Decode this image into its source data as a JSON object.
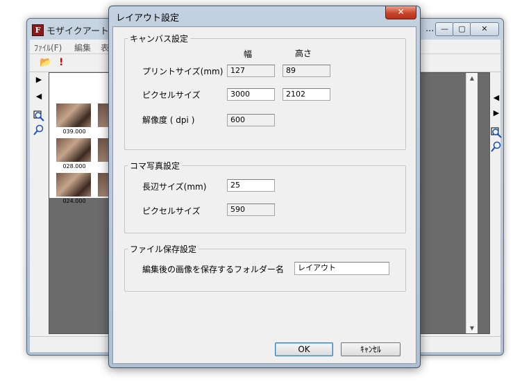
{
  "app_window": {
    "app_icon_letter": "F",
    "title": "モザイクアートテ",
    "title_overflow": "...",
    "controls": {
      "minimize": "—",
      "maximize": "▢",
      "close": "✕"
    },
    "menu": [
      "ﾌｧｲﾙ(F)",
      "編集",
      "表"
    ],
    "toolbar": {
      "open_icon": "📂",
      "alert_icon": "!"
    },
    "side_left": {
      "next": "▶",
      "prev": "◀"
    },
    "side_right": {
      "prev": "◀",
      "next": "▶"
    },
    "thumbnails": [
      {
        "label": "039.000"
      },
      {
        "label": "028.000"
      },
      {
        "label": "024.000"
      }
    ]
  },
  "dialog": {
    "title": "レイアウト設定",
    "close_label": "✕",
    "canvas_group": {
      "legend": "キャンバス設定",
      "col_width": "幅",
      "col_height": "高さ",
      "print_size_label": "プリントサイズ(mm)",
      "print_width": "127",
      "print_height": "89",
      "pixel_size_label": "ピクセルサイズ",
      "pixel_width": "3000",
      "pixel_height": "2102",
      "resolution_label": "解像度 ( dpi )",
      "resolution": "600"
    },
    "frame_group": {
      "legend": "コマ写真設定",
      "long_side_label": "長辺サイズ(mm)",
      "long_side": "25",
      "pixel_size_label": "ピクセルサイズ",
      "pixel_size": "590"
    },
    "save_group": {
      "legend": "ファイル保存設定",
      "folder_label": "編集後の画像を保存するフォルダー名",
      "folder_name": "レイアウト"
    },
    "ok_label": "OK",
    "cancel_label": "ｷｬﾝｾﾙ"
  }
}
